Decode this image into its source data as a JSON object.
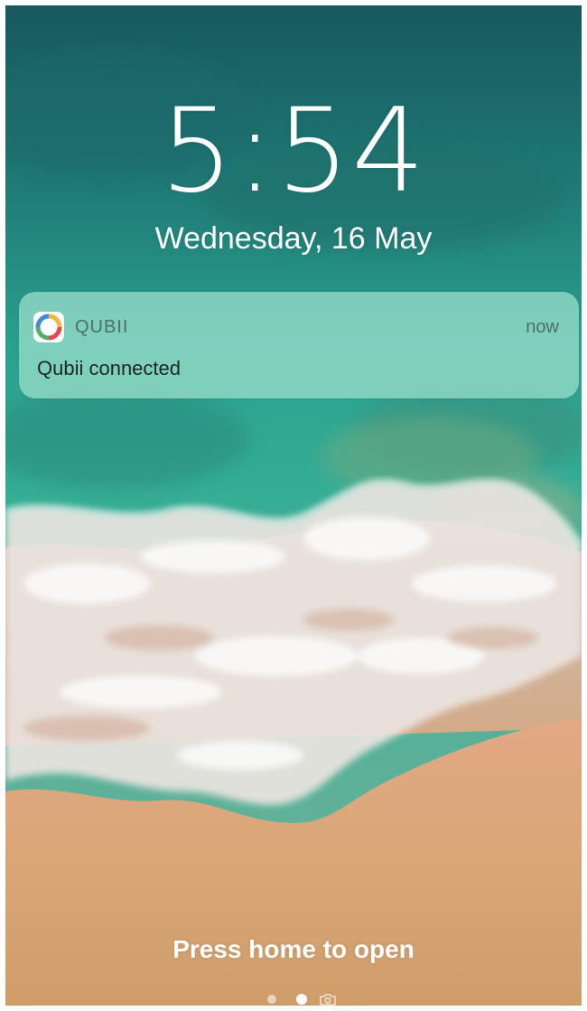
{
  "lock_screen": {
    "time": "5:54",
    "date": "Wednesday, 16 May",
    "hint": "Press home to open"
  },
  "notification": {
    "app_name": "QUBII",
    "time": "now",
    "message": "Qubii connected",
    "app_icon": "qubii-app-icon"
  },
  "page_indicator": {
    "page_count": 2,
    "current_page": 2,
    "trailing_icon": "camera-icon"
  },
  "colors": {
    "sea_deep": "#1a6e6e",
    "sea_turquoise": "#2fb09a",
    "foam": "#f3eee9",
    "sand": "#d6a574",
    "notification_bg": "#96dcc8"
  }
}
